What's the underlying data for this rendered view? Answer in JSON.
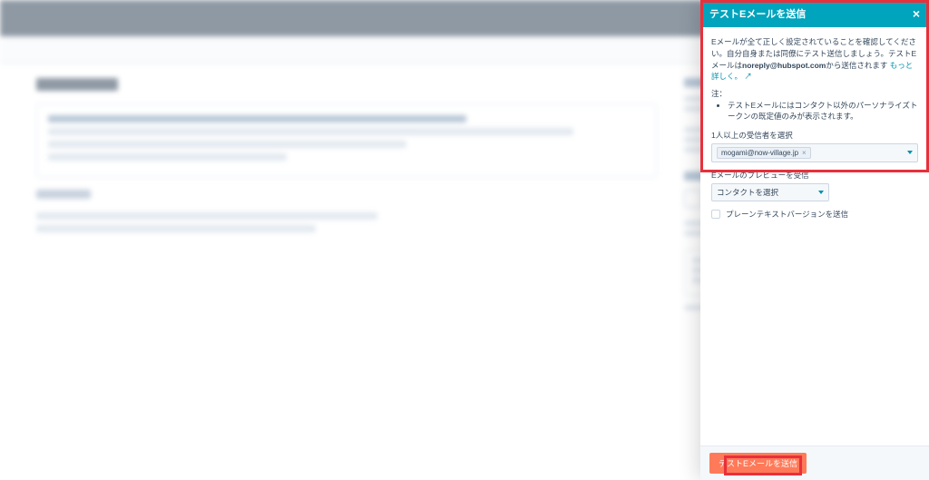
{
  "panel": {
    "title": "テストEメールを送信",
    "close": "×",
    "intro_1": "Eメールが全て正しく設定されていることを確認してください。自分自身または同僚にテスト送信しましょう。テストEメールは",
    "intro_bold": "noreply@hubspot.com",
    "intro_2": "から送信されます",
    "learn_more": "もっと詳しく。",
    "learn_more_icon": "↗",
    "note_label": "注：",
    "note_item": "テストEメールにはコンタクト以外のパーソナライズトークンの既定値のみが表示されます。",
    "recipients_label": "1人以上の受信者を選択",
    "recipient_chip": "mogami@now-village.jp",
    "chip_remove": "×",
    "preview_label": "Eメールのプレビューを受信",
    "preview_placeholder": "コンタクトを選択",
    "plaintext_label": "プレーンテキストバージョンを送信"
  },
  "footer": {
    "send": "テストEメールを送信"
  }
}
